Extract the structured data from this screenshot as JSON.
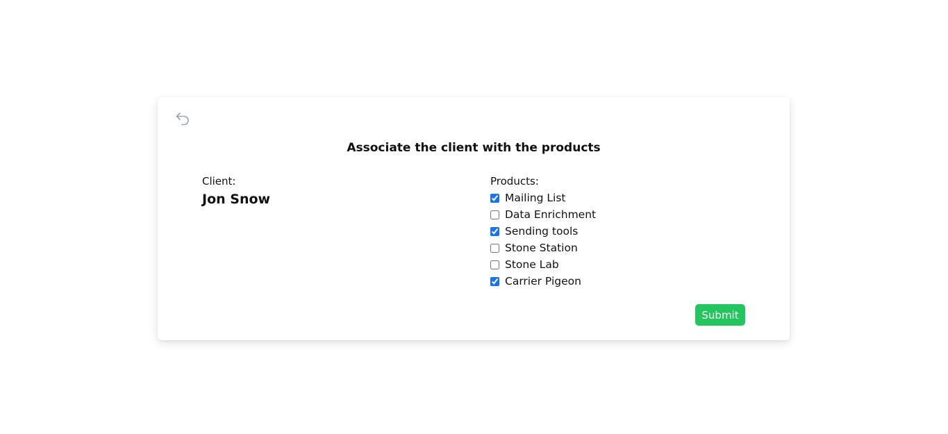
{
  "back": {
    "icon": "undo-arrow-icon"
  },
  "title": "Associate the client with the products",
  "client": {
    "label": "Client:",
    "name": "Jon Snow"
  },
  "products": {
    "label": "Products:",
    "items": [
      {
        "label": "Mailing List",
        "checked": true
      },
      {
        "label": "Data Enrichment",
        "checked": false
      },
      {
        "label": "Sending tools",
        "checked": true
      },
      {
        "label": "Stone Station",
        "checked": false
      },
      {
        "label": "Stone Lab",
        "checked": false
      },
      {
        "label": "Carrier Pigeon",
        "checked": true
      }
    ]
  },
  "submit": {
    "label": "Submit"
  },
  "colors": {
    "accent": "#22c55e",
    "checkbox": "#1a73e8",
    "icon": "#9aa3b2"
  }
}
